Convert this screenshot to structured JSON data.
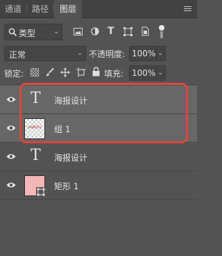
{
  "tabs": [
    {
      "label": "通道",
      "active": false
    },
    {
      "label": "路径",
      "active": false
    },
    {
      "label": "图层",
      "active": true
    }
  ],
  "filter": {
    "label": "类型"
  },
  "blend": {
    "mode": "正常",
    "opacity_label": "不透明度:",
    "opacity_value": "100%"
  },
  "lock": {
    "label": "锁定:",
    "fill_label": "填充:",
    "fill_value": "100%"
  },
  "layers": [
    {
      "name": "海报设计",
      "kind": "text",
      "visible": true,
      "selected": true
    },
    {
      "name": "组 1",
      "kind": "group",
      "visible": true,
      "selected": true,
      "thumb_text": "@海报设计"
    },
    {
      "name": "海报设计",
      "kind": "text",
      "visible": true,
      "selected": false
    },
    {
      "name": "矩形 1",
      "kind": "shape",
      "visible": true,
      "selected": false
    }
  ],
  "colors": {
    "panel": "#535353",
    "tabbar": "#424242",
    "selected_row": "#676767",
    "highlight": "#e0463a",
    "rect_fill": "#f4b6b6"
  }
}
